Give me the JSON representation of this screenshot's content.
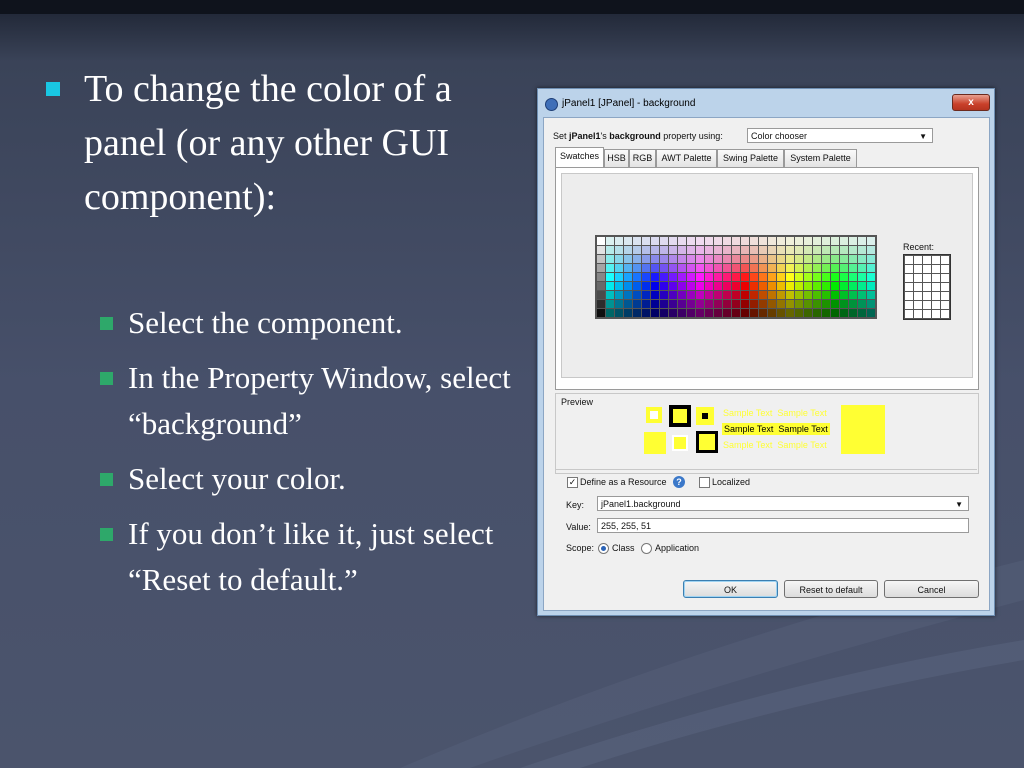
{
  "slide": {
    "main_bullet": "To change the color of a panel (or any other GUI component):",
    "sub_bullets": [
      "Select the component.",
      "In the Property Window, select “background”",
      "Select your color.",
      "If  you don’t like it, just select “Reset to default.”"
    ],
    "colors": {
      "main_bullet": "#19c7e3",
      "sub_bullet": "#2ea86a",
      "text": "#ffffff"
    }
  },
  "dialog": {
    "title": "jPanel1 [JPanel] - background",
    "close_glyph": "x",
    "set_prefix": "Set ",
    "set_component": "jPanel1",
    "set_middle": "'s ",
    "set_property": "background",
    "set_suffix": " property using:",
    "mode_selected": "Color chooser",
    "tabs": [
      "Swatches",
      "HSB",
      "RGB",
      "AWT Palette",
      "Swing Palette",
      "System Palette"
    ],
    "recent_label": "Recent:",
    "preview_label": "Preview",
    "sample_text": "Sample Text",
    "selected_color": "#ffff33",
    "define_resource_label": "Define as a Resource",
    "define_resource_checked": true,
    "localized_label": "Localized",
    "localized_checked": false,
    "key_label": "Key:",
    "key_value": "jPanel1.background",
    "value_label": "Value:",
    "value_value": "255, 255, 51",
    "scope_label": "Scope:",
    "scope_class": "Class",
    "scope_application": "Application",
    "scope_selected": "Class",
    "buttons": {
      "ok": "OK",
      "reset": "Reset to default",
      "cancel": "Cancel"
    }
  }
}
